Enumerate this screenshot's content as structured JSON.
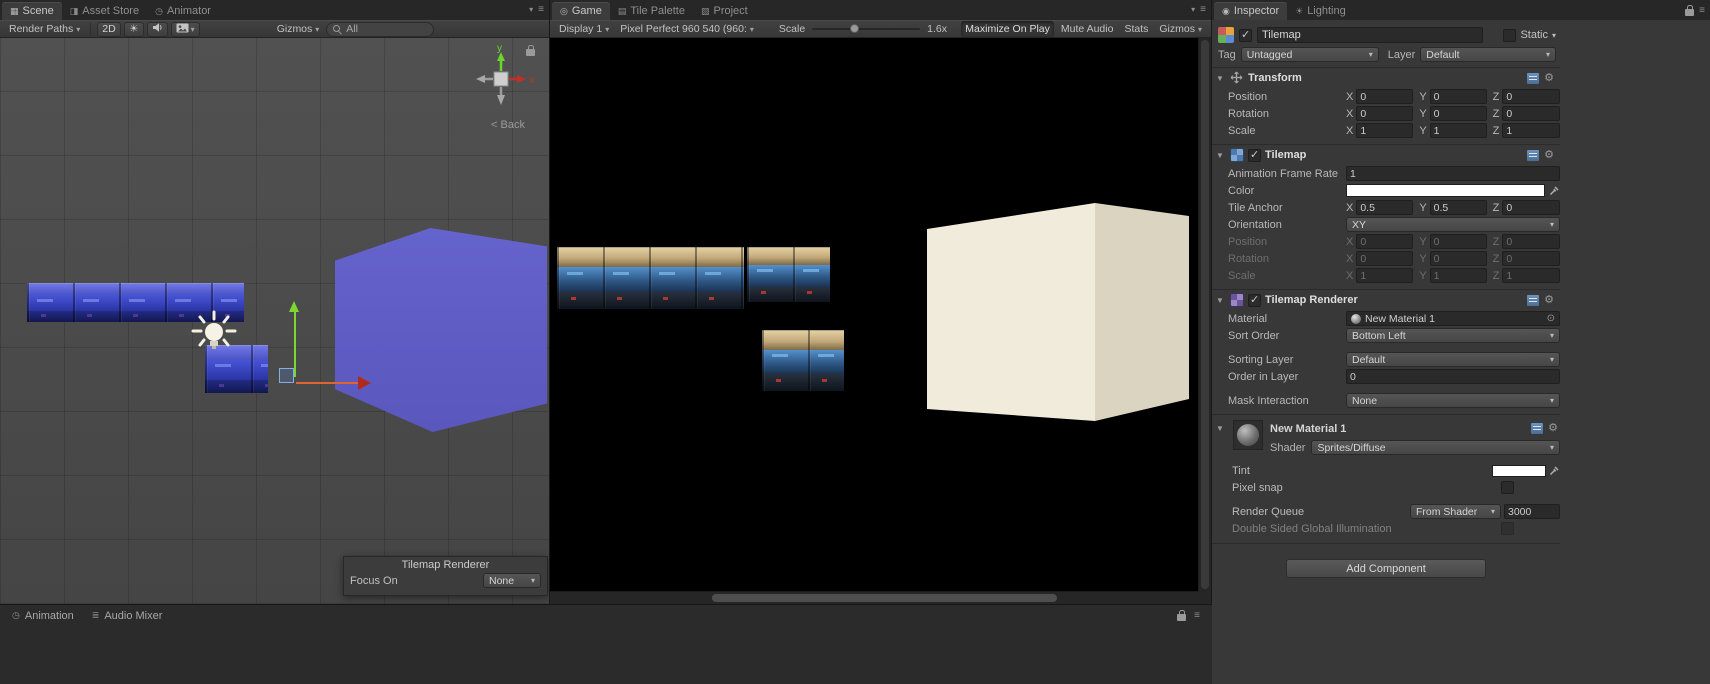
{
  "icons": {
    "menu": "≡",
    "caret": "▾",
    "fold": "▼",
    "gear": "⚙",
    "target": "⊙",
    "sun": "☀",
    "tab_scene": "▦",
    "tab_asset_store": "◨",
    "tab_animator": "◷",
    "tab_game": "◎",
    "tab_tile_palette": "▤",
    "tab_project": "▧",
    "tab_inspector": "◉",
    "tab_lighting": "☀",
    "tab_animation": "◷",
    "tab_audio_mixer": "≣"
  },
  "colors": {
    "scene_selection_shape": "#615FC7",
    "game_cube_front": "#F1EBDC",
    "game_cube_side": "#DBD4C0",
    "axis_green": "#7CD82F",
    "axis_red": "#B02A20",
    "axis_orange": "#E0642F"
  },
  "scene": {
    "tabs": [
      {
        "label": "Scene"
      },
      {
        "label": "Asset Store"
      },
      {
        "label": "Animator"
      }
    ],
    "toolbar": {
      "render_paths": "Render Paths",
      "mode_2d": "2D",
      "gizmos": "Gizmos",
      "search_value": "All"
    },
    "view_gizmo": {
      "y": "y",
      "x": "x",
      "back": "< Back"
    },
    "overlay": {
      "title": "Tilemap Renderer",
      "focus_label": "Focus On",
      "focus_value": "None"
    }
  },
  "game": {
    "tabs": [
      {
        "label": "Game"
      },
      {
        "label": "Tile Palette"
      },
      {
        "label": "Project"
      }
    ],
    "toolbar": {
      "display": "Display 1",
      "aspect": "Pixel Perfect 960 540 (960:",
      "scale_label": "Scale",
      "scale_value": "1.6x",
      "maximize": "Maximize On Play",
      "mute": "Mute Audio",
      "stats": "Stats",
      "gizmos": "Gizmos"
    }
  },
  "bottom": {
    "animation_tab": "Animation",
    "audio_mixer_tab": "Audio Mixer"
  },
  "inspector": {
    "tabs": [
      {
        "label": "Inspector"
      },
      {
        "label": "Lighting"
      }
    ],
    "header": {
      "name": "Tilemap",
      "static_label": "Static",
      "tag_label": "Tag",
      "tag_value": "Untagged",
      "layer_label": "Layer",
      "layer_value": "Default"
    },
    "axis": {
      "x": "X",
      "y": "Y",
      "z": "Z"
    },
    "transform": {
      "title": "Transform",
      "position": {
        "label": "Position",
        "x": "0",
        "y": "0",
        "z": "0"
      },
      "rotation": {
        "label": "Rotation",
        "x": "0",
        "y": "0",
        "z": "0"
      },
      "scale": {
        "label": "Scale",
        "x": "1",
        "y": "1",
        "z": "1"
      }
    },
    "tilemap": {
      "title": "Tilemap",
      "anim_rate_label": "Animation Frame Rate",
      "anim_rate_value": "1",
      "color_label": "Color",
      "tile_anchor": {
        "label": "Tile Anchor",
        "x": "0.5",
        "y": "0.5",
        "z": "0"
      },
      "orientation_label": "Orientation",
      "orientation_value": "XY",
      "position": {
        "label": "Position",
        "x": "0",
        "y": "0",
        "z": "0"
      },
      "rotation": {
        "label": "Rotation",
        "x": "0",
        "y": "0",
        "z": "0"
      },
      "scale": {
        "label": "Scale",
        "x": "1",
        "y": "1",
        "z": "1"
      }
    },
    "tilemap_renderer": {
      "title": "Tilemap Renderer",
      "material_label": "Material",
      "material_value": "New Material 1",
      "sort_order_label": "Sort Order",
      "sort_order_value": "Bottom Left",
      "sorting_layer_label": "Sorting Layer",
      "sorting_layer_value": "Default",
      "order_in_layer_label": "Order in Layer",
      "order_in_layer_value": "0",
      "mask_interaction_label": "Mask Interaction",
      "mask_interaction_value": "None"
    },
    "material": {
      "title": "New Material 1",
      "shader_label": "Shader",
      "shader_value": "Sprites/Diffuse",
      "tint_label": "Tint",
      "pixel_snap_label": "Pixel snap",
      "render_queue_label": "Render Queue",
      "render_queue_mode": "From Shader",
      "render_queue_value": "3000",
      "dsgi_label": "Double Sided Global Illumination"
    },
    "add_component": "Add Component"
  }
}
